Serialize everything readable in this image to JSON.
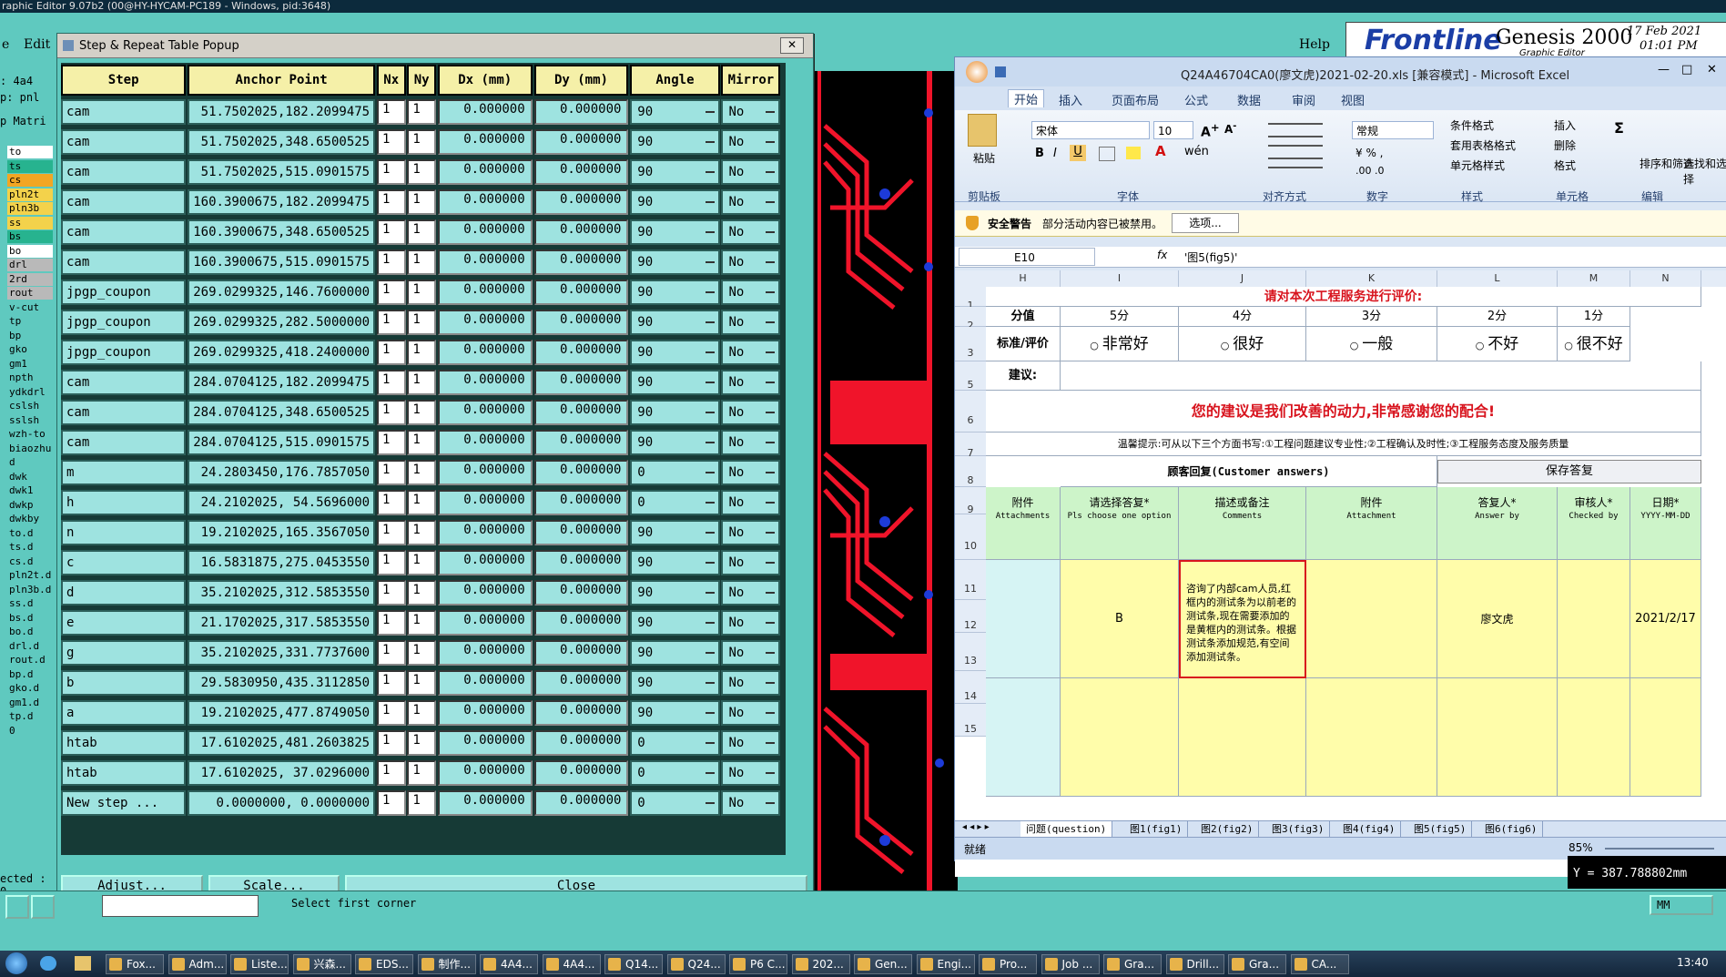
{
  "graphic_editor": {
    "window_title": "raphic Editor 9.07b2 (00@HY-HYCAM-PC189 - Windows, pid:3648)",
    "menu_left": [
      "e",
      "Edit"
    ],
    "menu_help": "Help",
    "brand": "Frontline",
    "product": "Genesis 2000",
    "product_sub": "Graphic Editor",
    "date": "17 Feb 2021",
    "time": "01:01 PM",
    "job_label": ": 4a4",
    "step_label": "p: pnl",
    "matrix_label": "p Matri",
    "layers": [
      {
        "name": "to",
        "bg": "#ffffff"
      },
      {
        "name": "ts",
        "bg": "#27b38f"
      },
      {
        "name": "cs",
        "bg": "#f2a623"
      },
      {
        "name": "pln2t",
        "bg": "#f3d24b"
      },
      {
        "name": "pln3b",
        "bg": "#f3d24b"
      },
      {
        "name": "ss",
        "bg": "#f3d24b"
      },
      {
        "name": "bs",
        "bg": "#27b38f"
      },
      {
        "name": "bo",
        "bg": "#ffffff"
      },
      {
        "name": "drl",
        "bg": "#b9b9b9"
      },
      {
        "name": "2rd",
        "bg": "#b9b9b9"
      },
      {
        "name": "rout",
        "bg": "#b9b9b9"
      },
      {
        "name": "v-cut",
        "bg": "#5fc9bf"
      },
      {
        "name": "tp",
        "bg": "#5fc9bf"
      },
      {
        "name": "bp",
        "bg": "#5fc9bf"
      },
      {
        "name": "gko",
        "bg": "#5fc9bf"
      },
      {
        "name": "gm1",
        "bg": "#5fc9bf"
      },
      {
        "name": "npth",
        "bg": "#5fc9bf"
      },
      {
        "name": "ydkdrl",
        "bg": "#5fc9bf"
      },
      {
        "name": "cslsh",
        "bg": "#5fc9bf"
      },
      {
        "name": "sslsh",
        "bg": "#5fc9bf"
      },
      {
        "name": "wzh-to",
        "bg": "#5fc9bf"
      },
      {
        "name": "biaozhu",
        "bg": "#5fc9bf"
      },
      {
        "name": "d",
        "bg": "#5fc9bf"
      },
      {
        "name": "dwk",
        "bg": "#5fc9bf"
      },
      {
        "name": "dwk1",
        "bg": "#5fc9bf"
      },
      {
        "name": "dwkp",
        "bg": "#5fc9bf"
      },
      {
        "name": "dwkby",
        "bg": "#5fc9bf"
      },
      {
        "name": "to.d",
        "bg": "#5fc9bf"
      },
      {
        "name": "ts.d",
        "bg": "#5fc9bf"
      },
      {
        "name": "cs.d",
        "bg": "#5fc9bf"
      },
      {
        "name": "pln2t.d",
        "bg": "#5fc9bf"
      },
      {
        "name": "pln3b.d",
        "bg": "#5fc9bf"
      },
      {
        "name": "ss.d",
        "bg": "#5fc9bf"
      },
      {
        "name": "bs.d",
        "bg": "#5fc9bf"
      },
      {
        "name": "bo.d",
        "bg": "#5fc9bf"
      },
      {
        "name": "drl.d",
        "bg": "#5fc9bf"
      },
      {
        "name": "rout.d",
        "bg": "#5fc9bf"
      },
      {
        "name": "bp.d",
        "bg": "#5fc9bf"
      },
      {
        "name": "gko.d",
        "bg": "#5fc9bf"
      },
      {
        "name": "gm1.d",
        "bg": "#5fc9bf"
      },
      {
        "name": "tp.d",
        "bg": "#5fc9bf"
      },
      {
        "name": "0",
        "bg": "#5fc9bf"
      }
    ],
    "selected_label": "ected : 0",
    "coord_y": "Y = 387.788802mm",
    "units": "MM",
    "status_prompt": "Select first corner"
  },
  "popup": {
    "title": "Step & Repeat Table Popup",
    "headers": [
      "Step",
      "Anchor Point",
      "Nx",
      "Ny",
      "Dx (mm)",
      "Dy (mm)",
      "Angle",
      "Mirror"
    ],
    "rows": [
      {
        "step": "cam",
        "anchor": "51.7502025,182.2099475",
        "nx": "1",
        "ny": "1",
        "dx": "0.000000",
        "dy": "0.000000",
        "angle": "90",
        "mirror": "No"
      },
      {
        "step": "cam",
        "anchor": "51.7502025,348.6500525",
        "nx": "1",
        "ny": "1",
        "dx": "0.000000",
        "dy": "0.000000",
        "angle": "90",
        "mirror": "No"
      },
      {
        "step": "cam",
        "anchor": "51.7502025,515.0901575",
        "nx": "1",
        "ny": "1",
        "dx": "0.000000",
        "dy": "0.000000",
        "angle": "90",
        "mirror": "No"
      },
      {
        "step": "cam",
        "anchor": "160.3900675,182.2099475",
        "nx": "1",
        "ny": "1",
        "dx": "0.000000",
        "dy": "0.000000",
        "angle": "90",
        "mirror": "No"
      },
      {
        "step": "cam",
        "anchor": "160.3900675,348.6500525",
        "nx": "1",
        "ny": "1",
        "dx": "0.000000",
        "dy": "0.000000",
        "angle": "90",
        "mirror": "No"
      },
      {
        "step": "cam",
        "anchor": "160.3900675,515.0901575",
        "nx": "1",
        "ny": "1",
        "dx": "0.000000",
        "dy": "0.000000",
        "angle": "90",
        "mirror": "No"
      },
      {
        "step": "jpgp_coupon",
        "anchor": "269.0299325,146.7600000",
        "nx": "1",
        "ny": "1",
        "dx": "0.000000",
        "dy": "0.000000",
        "angle": "90",
        "mirror": "No"
      },
      {
        "step": "jpgp_coupon",
        "anchor": "269.0299325,282.5000000",
        "nx": "1",
        "ny": "1",
        "dx": "0.000000",
        "dy": "0.000000",
        "angle": "90",
        "mirror": "No"
      },
      {
        "step": "jpgp_coupon",
        "anchor": "269.0299325,418.2400000",
        "nx": "1",
        "ny": "1",
        "dx": "0.000000",
        "dy": "0.000000",
        "angle": "90",
        "mirror": "No"
      },
      {
        "step": "cam",
        "anchor": "284.0704125,182.2099475",
        "nx": "1",
        "ny": "1",
        "dx": "0.000000",
        "dy": "0.000000",
        "angle": "90",
        "mirror": "No"
      },
      {
        "step": "cam",
        "anchor": "284.0704125,348.6500525",
        "nx": "1",
        "ny": "1",
        "dx": "0.000000",
        "dy": "0.000000",
        "angle": "90",
        "mirror": "No"
      },
      {
        "step": "cam",
        "anchor": "284.0704125,515.0901575",
        "nx": "1",
        "ny": "1",
        "dx": "0.000000",
        "dy": "0.000000",
        "angle": "90",
        "mirror": "No"
      },
      {
        "step": "m",
        "anchor": "24.2803450,176.7857050",
        "nx": "1",
        "ny": "1",
        "dx": "0.000000",
        "dy": "0.000000",
        "angle": "0",
        "mirror": "No"
      },
      {
        "step": "h",
        "anchor": "24.2102025, 54.5696000",
        "nx": "1",
        "ny": "1",
        "dx": "0.000000",
        "dy": "0.000000",
        "angle": "0",
        "mirror": "No"
      },
      {
        "step": "n",
        "anchor": "19.2102025,165.3567050",
        "nx": "1",
        "ny": "1",
        "dx": "0.000000",
        "dy": "0.000000",
        "angle": "90",
        "mirror": "No"
      },
      {
        "step": "c",
        "anchor": "16.5831875,275.0453550",
        "nx": "1",
        "ny": "1",
        "dx": "0.000000",
        "dy": "0.000000",
        "angle": "90",
        "mirror": "No"
      },
      {
        "step": "d",
        "anchor": "35.2102025,312.5853550",
        "nx": "1",
        "ny": "1",
        "dx": "0.000000",
        "dy": "0.000000",
        "angle": "90",
        "mirror": "No"
      },
      {
        "step": "e",
        "anchor": "21.1702025,317.5853550",
        "nx": "1",
        "ny": "1",
        "dx": "0.000000",
        "dy": "0.000000",
        "angle": "90",
        "mirror": "No"
      },
      {
        "step": "g",
        "anchor": "35.2102025,331.7737600",
        "nx": "1",
        "ny": "1",
        "dx": "0.000000",
        "dy": "0.000000",
        "angle": "90",
        "mirror": "No"
      },
      {
        "step": "b",
        "anchor": "29.5830950,435.3112850",
        "nx": "1",
        "ny": "1",
        "dx": "0.000000",
        "dy": "0.000000",
        "angle": "90",
        "mirror": "No"
      },
      {
        "step": "a",
        "anchor": "19.2102025,477.8749050",
        "nx": "1",
        "ny": "1",
        "dx": "0.000000",
        "dy": "0.000000",
        "angle": "90",
        "mirror": "No"
      },
      {
        "step": "htab",
        "anchor": "17.6102025,481.2603825",
        "nx": "1",
        "ny": "1",
        "dx": "0.000000",
        "dy": "0.000000",
        "angle": "0",
        "mirror": "No"
      },
      {
        "step": "htab",
        "anchor": "17.6102025, 37.0296000",
        "nx": "1",
        "ny": "1",
        "dx": "0.000000",
        "dy": "0.000000",
        "angle": "0",
        "mirror": "No"
      },
      {
        "step": "New step ...",
        "anchor": "0.0000000,  0.0000000",
        "nx": "1",
        "ny": "1",
        "dx": "0.000000",
        "dy": "0.000000",
        "angle": "0",
        "mirror": "No"
      }
    ],
    "buttons": {
      "adjust": "Adjust...",
      "scale": "Scale...",
      "close": "Close"
    }
  },
  "excel": {
    "title": "Q24A46704CA0(廖文虎)2021-02-20.xls [兼容模式] - Microsoft Excel",
    "tabs": [
      "开始",
      "插入",
      "页面布局",
      "公式",
      "数据",
      "审阅",
      "视图"
    ],
    "groups": [
      "剪贴板",
      "字体",
      "对齐方式",
      "数字",
      "样式",
      "单元格",
      "编辑"
    ],
    "paste_label": "粘贴",
    "font_name": "宋体",
    "font_size": "10",
    "number_format": "常规",
    "style_items": [
      "条件格式",
      "套用表格格式",
      "单元格样式"
    ],
    "cell_items": [
      "插入",
      "删除",
      "格式"
    ],
    "edit_items": [
      "排序和筛选",
      "查找和选择"
    ],
    "security_label": "安全警告",
    "security_text": "部分活动内容已被禁用。",
    "security_button": "选项...",
    "name_box": "E10",
    "formula": "'图5(fig5)'",
    "columns": [
      "H",
      "I",
      "J",
      "K",
      "L",
      "M",
      "N"
    ],
    "rows": [
      "1",
      "2",
      "3",
      "5",
      "6",
      "7",
      "8",
      "9",
      "10",
      "11",
      "12",
      "13",
      "14",
      "15"
    ],
    "sheet": {
      "heading": "请对本次工程服务进行评价:",
      "score_label": "分值",
      "scores": [
        "5分",
        "4分",
        "3分",
        "2分",
        "1分"
      ],
      "rating_label": "标准/评价",
      "ratings": [
        "非常好",
        "很好",
        "一般",
        "不好",
        "很不好"
      ],
      "suggest_label": "建议:",
      "motto": "您的建议是我们改善的动力,非常感谢您的配合!",
      "tip": "温馨提示:可从以下三个方面书写:①工程问题建议专业性;②工程确认及时性;③工程服务态度及服务质量",
      "customer_answers": "顾客回复(Customer answers)",
      "save_answer": "保存答复",
      "col_headers": [
        {
          "cn": "附件",
          "en": "Attachments"
        },
        {
          "cn": "请选择答复*",
          "en": "Pls choose one option"
        },
        {
          "cn": "描述或备注",
          "en": "Comments"
        },
        {
          "cn": "附件",
          "en": "Attachment"
        },
        {
          "cn": "答复人*",
          "en": "Answer by"
        },
        {
          "cn": "审核人*",
          "en": "Checked by"
        },
        {
          "cn": "日期*",
          "en": "YYYY-MM-DD"
        }
      ],
      "answer_option": "B",
      "comment": "咨询了内部cam人员,红框内的测试条为以前老的测试条,现在需要添加的是黄框内的测试条。根据测试条添加规范,有空间添加测试条。",
      "answer_by": "廖文虎",
      "date": "2021/2/17"
    },
    "sheet_tabs": [
      "问题(question)",
      "图1(fig1)",
      "图2(fig2)",
      "图3(fig3)",
      "图4(fig4)",
      "图5(fig5)",
      "图6(fig6)"
    ],
    "status_ready": "就绪",
    "zoom": "85%"
  },
  "taskbar": {
    "items": [
      "Fox...",
      "Adm...",
      "Liste...",
      "兴森...",
      "EDS...",
      "制作...",
      "4A4...",
      "4A4...",
      "Q14...",
      "Q24...",
      "P6 C...",
      "202...",
      "Gen...",
      "Engi...",
      "Pro...",
      "Job ...",
      "Gra...",
      "Drill...",
      "Gra...",
      "CA..."
    ],
    "clock": "13:40"
  }
}
